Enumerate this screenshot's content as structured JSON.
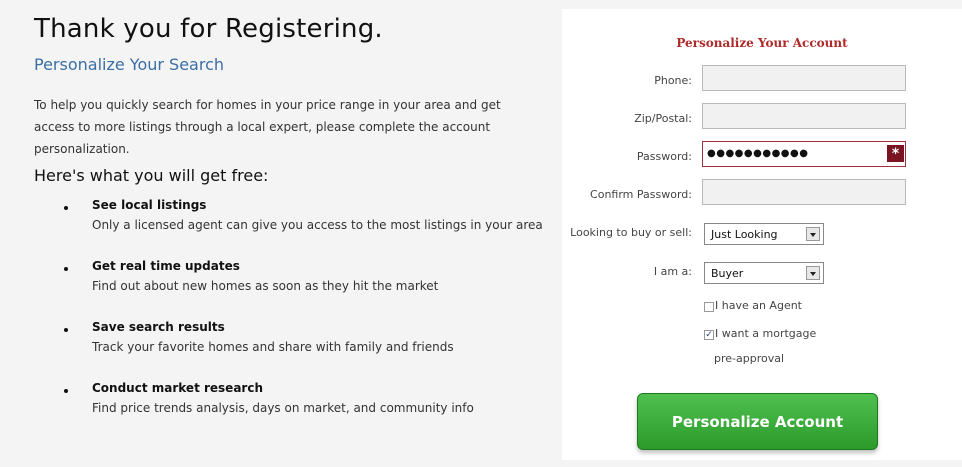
{
  "page": {
    "title": "Thank you for Registering.",
    "subtitle": "Personalize Your Search",
    "intro": "To help you quickly search for homes in your price range in your area and get access to more listings through a local expert, please complete the account personalization.",
    "free_title": "Here's what you will get free:",
    "benefits": [
      {
        "title": "See local listings",
        "desc": "Only a licensed agent can give you access to the most listings in your area"
      },
      {
        "title": "Get real time updates",
        "desc": "Find out about new homes as soon as they hit the market"
      },
      {
        "title": "Save search results",
        "desc": "Track your favorite homes and share with family and friends"
      },
      {
        "title": "Conduct market research",
        "desc": "Find price trends analysis, days on market, and community info"
      }
    ]
  },
  "form": {
    "title": "Personalize Your Account",
    "phone_label": "Phone:",
    "phone_value": "",
    "zip_label": "Zip/Postal:",
    "zip_value": "",
    "password_label": "Password:",
    "password_mask": "●●●●●●●●●●●",
    "password_required_icon": "asterisk-icon",
    "confirm_label": "Confirm Password:",
    "confirm_value": "",
    "buy_sell_label": "Looking to buy or sell:",
    "buy_sell_value": "Just Looking",
    "iam_label": "I am a:",
    "iam_value": "Buyer",
    "agent_label": "I have an Agent",
    "agent_checked": false,
    "mortgage_label_line1": "I want a mortgage",
    "mortgage_label_line2": "pre-approval",
    "mortgage_checked": true,
    "submit_label": "Personalize Account"
  },
  "colors": {
    "subtitle": "#3b6ea5",
    "form_title": "#b02a2a",
    "error_border": "#a3303e",
    "button_green": "#2b9a2b"
  }
}
